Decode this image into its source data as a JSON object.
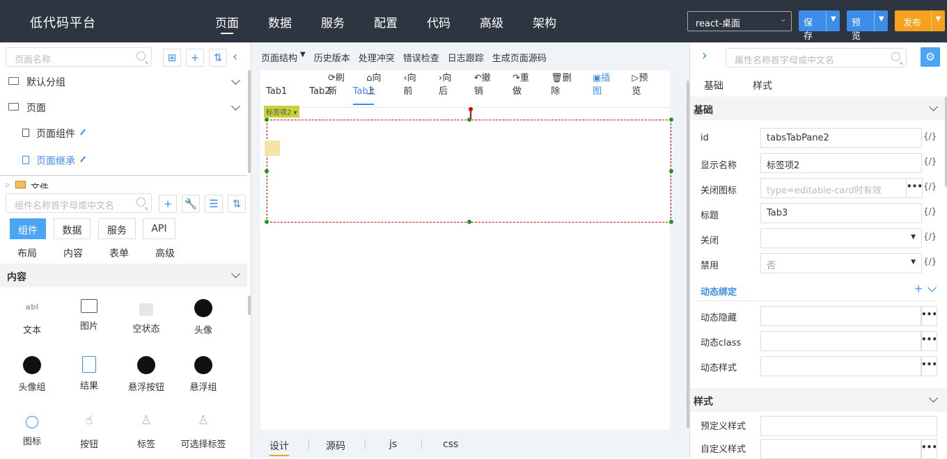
{
  "header": {
    "logo": "低代码平台",
    "nav": [
      "页面",
      "数据",
      "服务",
      "配置",
      "代码",
      "高级",
      "架构"
    ],
    "env": "react-桌面",
    "save": "保存",
    "preview": "预览",
    "publish": "发布"
  },
  "left": {
    "page_search_placeholder": "页面名称",
    "groups": [
      {
        "label": "默认分组"
      },
      {
        "label": "页面"
      }
    ],
    "pages": [
      {
        "label": "页面组件"
      },
      {
        "label": "页面继承"
      }
    ],
    "cut_row": "文件",
    "comp_search_placeholder": "组件名称首字母或中文名",
    "tabs": [
      "组件",
      "数据",
      "服务",
      "API"
    ],
    "cats": [
      "布局",
      "内容",
      "表单",
      "高级"
    ],
    "section": "内容",
    "components": [
      "文本",
      "图片",
      "空状态",
      "头像",
      "头像组",
      "结果",
      "悬浮按钮",
      "悬浮组",
      "图标",
      "按钮",
      "标签",
      "可选择标签"
    ]
  },
  "middle": {
    "toolbar": [
      "页面结构",
      "历史版本",
      "处理冲突",
      "错误检查",
      "日志跟踪",
      "生成页面源码"
    ],
    "actions": [
      "刷新",
      "向上",
      "向前",
      "向后",
      "撤销",
      "重做",
      "删除",
      "插图",
      "预览"
    ],
    "tabs": [
      "Tab1",
      "Tab2",
      "Tab3"
    ],
    "badge": "标签项2",
    "bottom": [
      "设计",
      "源码",
      "js",
      "css"
    ]
  },
  "right": {
    "search_placeholder": "属性名称首字母或中文名",
    "tabs": [
      "基础",
      "样式"
    ],
    "section_basic": "基础",
    "props": [
      {
        "label": "id",
        "value": "tabsTabPane2",
        "code": "{/}"
      },
      {
        "label": "显示名称",
        "value": "标签项2",
        "code": "{/}"
      },
      {
        "label": "关闭图标",
        "placeholder": "type=editable-card时有效",
        "code": "{/}"
      },
      {
        "label": "标题",
        "value": "Tab3",
        "code": "{/}"
      },
      {
        "label": "关闭",
        "value": "",
        "code": "{/}"
      },
      {
        "label": "禁用",
        "value": "否",
        "code": "{/}"
      }
    ],
    "dynamic_title": "动态绑定",
    "dynamic": [
      "动态隐藏",
      "动态class",
      "动态样式"
    ],
    "section_style": "样式",
    "style_props": [
      "预定义样式",
      "自定义样式"
    ]
  }
}
